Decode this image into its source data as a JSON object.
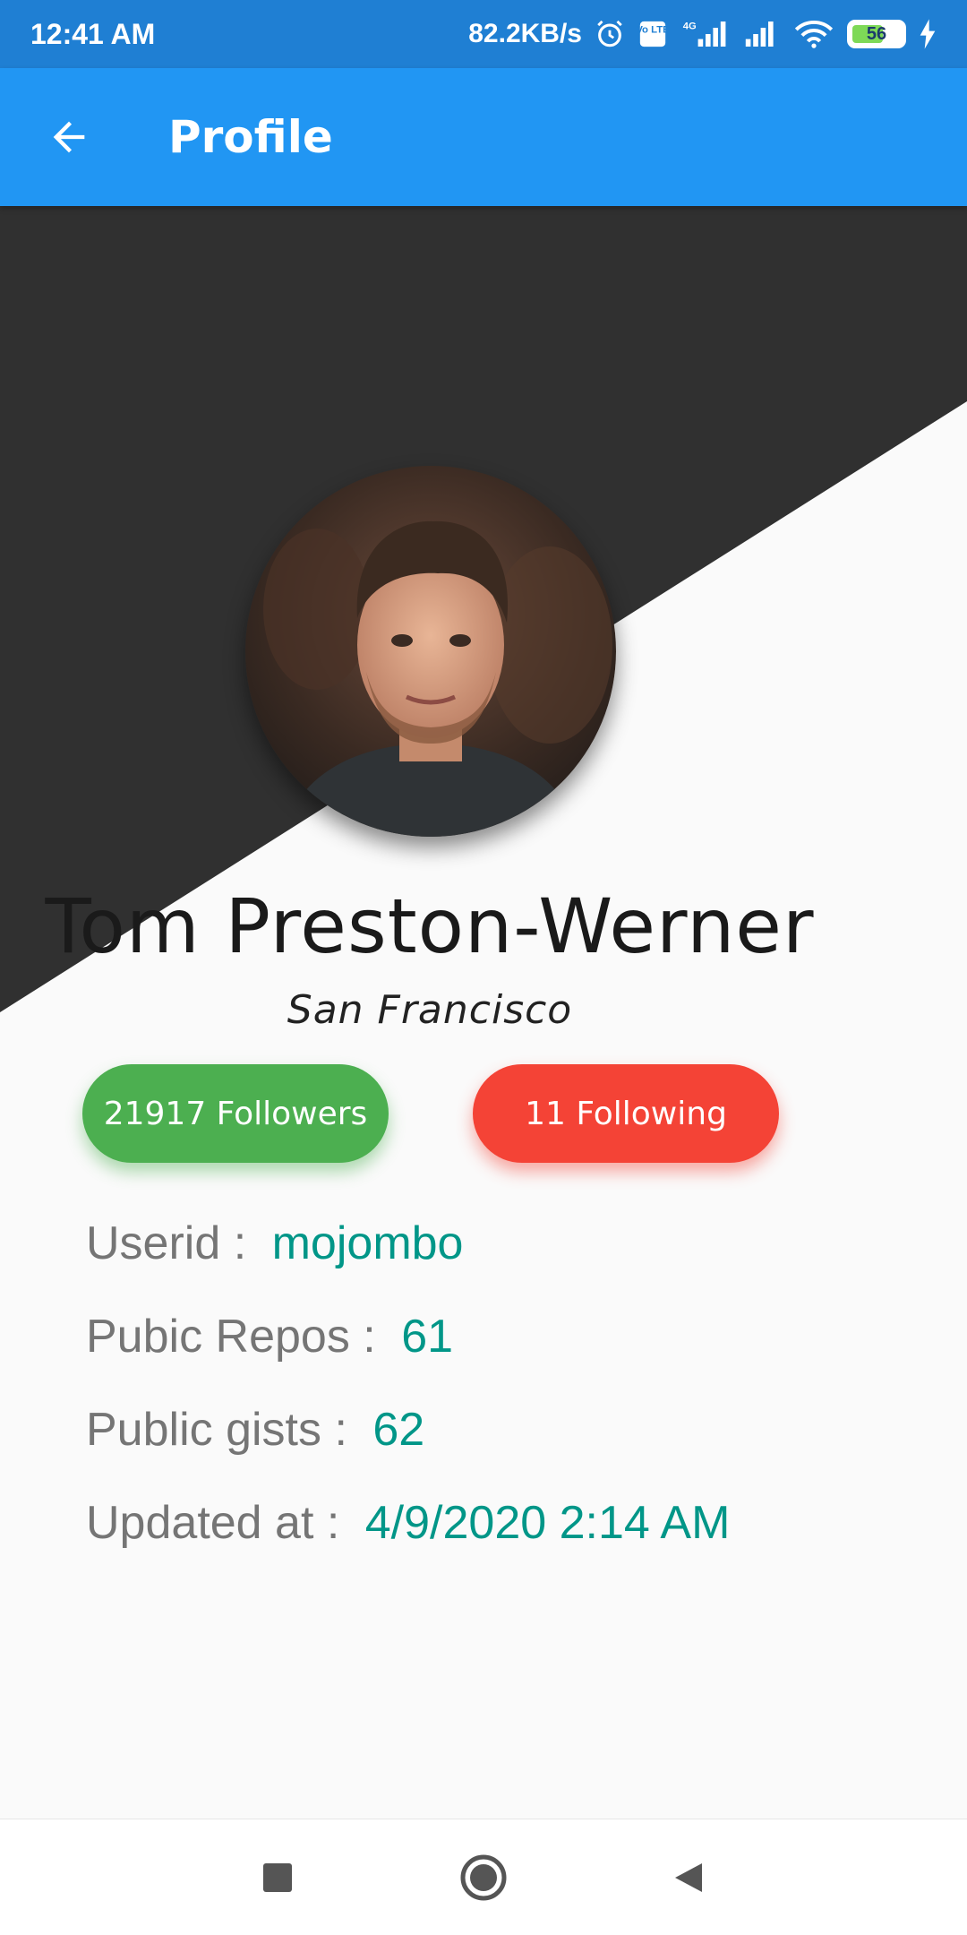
{
  "status_bar": {
    "time": "12:41 AM",
    "net_speed": "82.2KB/s",
    "battery": "56",
    "volte_label": "Vo LTE",
    "network_label": "4G",
    "icons": [
      "alarm-icon",
      "volte-icon",
      "signal-icon",
      "signal-icon",
      "wifi-icon",
      "battery-icon",
      "charging-icon"
    ]
  },
  "app_bar": {
    "title": "Profile",
    "back_icon": "arrow-back-icon"
  },
  "profile": {
    "name": "Tom Preston-Werner",
    "location": "San Francisco",
    "followers": "21917 Followers",
    "following": "11 Following",
    "userid_label": "Userid :",
    "userid": "mojombo",
    "repos_label": "Pubic Repos :",
    "repos": "61",
    "gists_label": "Public gists :",
    "gists": "62",
    "updated_label": "Updated at :",
    "updated": "4/9/2020 2:14 AM"
  },
  "colors": {
    "status_bar": "#1f7fd3",
    "app_bar": "#2196f3",
    "dark_bg": "#303030",
    "followers_button": "#4caf50",
    "following_button": "#f44336",
    "value_teal": "#009688",
    "label_grey": "#757575"
  },
  "nav_bar": {
    "icons": [
      "recent-apps-icon",
      "home-icon",
      "back-icon"
    ]
  }
}
